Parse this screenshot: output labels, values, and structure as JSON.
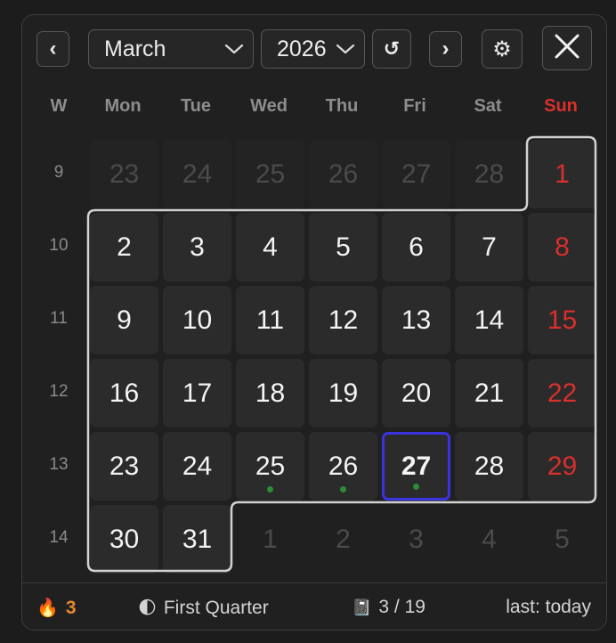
{
  "toolbar": {
    "prev_icon": "‹",
    "next_icon": "›",
    "reset_icon": "↺",
    "settings_icon": "⚙",
    "close_icon": "✕",
    "month": "March",
    "year": "2026"
  },
  "headers": {
    "week": "W",
    "days": [
      "Mon",
      "Tue",
      "Wed",
      "Thu",
      "Fri",
      "Sat",
      "Sun"
    ]
  },
  "weeks": [
    {
      "num": "9",
      "days": [
        "23",
        "24",
        "25",
        "26",
        "27",
        "28",
        "1"
      ]
    },
    {
      "num": "10",
      "days": [
        "2",
        "3",
        "4",
        "5",
        "6",
        "7",
        "8"
      ]
    },
    {
      "num": "11",
      "days": [
        "9",
        "10",
        "11",
        "12",
        "13",
        "14",
        "15"
      ]
    },
    {
      "num": "12",
      "days": [
        "16",
        "17",
        "18",
        "19",
        "20",
        "21",
        "22"
      ]
    },
    {
      "num": "13",
      "days": [
        "23",
        "24",
        "25",
        "26",
        "27",
        "28",
        "29"
      ]
    },
    {
      "num": "14",
      "days": [
        "30",
        "31",
        "1",
        "2",
        "3",
        "4",
        "5"
      ]
    }
  ],
  "today": "27",
  "event_days": [
    "25",
    "26",
    "27"
  ],
  "footer": {
    "streak_icon": "🔥",
    "streak_count": "3",
    "moon_icon": "🌓",
    "moon_phase": "First Quarter",
    "book_icon": "📓",
    "progress": "3 / 19",
    "last": "last: today"
  },
  "colors": {
    "sunday": "#d8302c",
    "today_border": "#3a33e0",
    "event_dot": "#2e8b3a",
    "streak": "#e8862c"
  }
}
